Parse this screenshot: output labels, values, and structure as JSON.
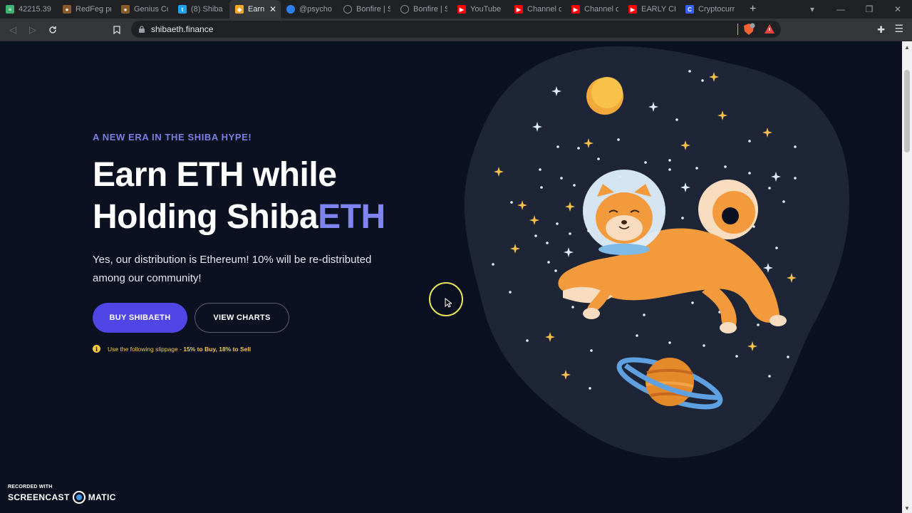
{
  "browser": {
    "tabs": [
      {
        "title": "42215.39",
        "icon": "chart-favicon",
        "color": "#3cb371",
        "active": false
      },
      {
        "title": "RedFeg pr",
        "icon": "poop-favicon",
        "color": "#8b5a2b",
        "active": false
      },
      {
        "title": "Genius Co",
        "icon": "poop-favicon",
        "color": "#8b5a2b",
        "active": false
      },
      {
        "title": "(8) Shiba",
        "icon": "twitter-favicon",
        "color": "#1da1f2",
        "active": false
      },
      {
        "title": "Earn ET",
        "icon": "shiba-favicon",
        "color": "#f5a623",
        "active": true
      },
      {
        "title": "@psycho",
        "icon": "circle-favicon",
        "color": "#2f80ed",
        "active": false
      },
      {
        "title": "Bonfire | S",
        "icon": "globe-favicon",
        "color": "#888888",
        "active": false
      },
      {
        "title": "Bonfire | S",
        "icon": "globe-favicon",
        "color": "#888888",
        "active": false
      },
      {
        "title": "YouTube",
        "icon": "youtube-favicon",
        "color": "#ff0000",
        "active": false
      },
      {
        "title": "Channel d",
        "icon": "youtube-favicon",
        "color": "#ff0000",
        "active": false
      },
      {
        "title": "Channel c",
        "icon": "youtube-favicon",
        "color": "#ff0000",
        "active": false
      },
      {
        "title": "EARLY CR",
        "icon": "youtube-favicon",
        "color": "#ff0000",
        "active": false
      },
      {
        "title": "Cryptocurr",
        "icon": "coinmarket-favicon",
        "color": "#3861fb",
        "active": false
      }
    ],
    "url": "shibaeth.finance"
  },
  "hero": {
    "eyebrow": "A NEW ERA IN THE SHIBA HYPE!",
    "headline_line1": "Earn ETH while",
    "headline_line2_plain": "Holding Shiba",
    "headline_line2_accent": "ETH",
    "description": "Yes, our distribution is Ethereum! 10% will be re-distributed among our community!",
    "buy_button": "BUY SHIBAETH",
    "charts_button": "VIEW CHARTS",
    "note_prefix": "Use the following slippage - ",
    "note_bold": "15% to Buy, 18% to Sell"
  },
  "watermark": {
    "recorded_with": "RECORDED WITH",
    "brand_left": "SCREENCAST",
    "brand_right": "MATIC"
  },
  "colors": {
    "background": "#0b1120",
    "accent": "#7f84f0",
    "buy_button": "#4f46e5",
    "note": "#f5c842"
  }
}
